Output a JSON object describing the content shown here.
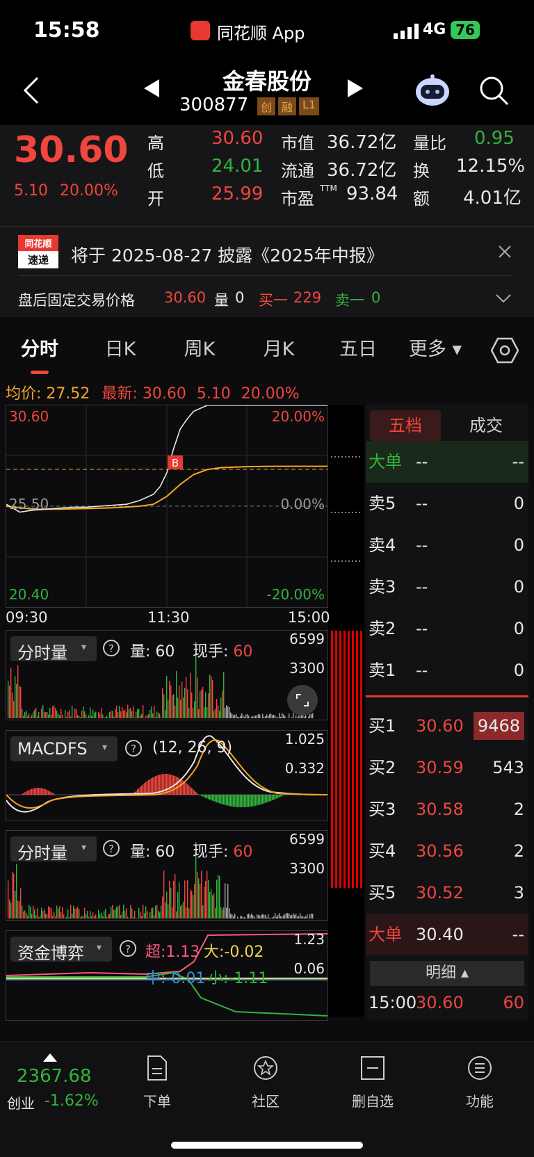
{
  "status": {
    "time": "15:58",
    "app": "同花顺 App",
    "network": "4G",
    "battery": "76"
  },
  "header": {
    "stock_name": "金春股份",
    "stock_code": "300877",
    "badges": [
      "创",
      "融",
      "L1"
    ]
  },
  "quote": {
    "price": "30.60",
    "change": "5.10",
    "change_pct": "20.00%",
    "high_label": "高",
    "high": "30.60",
    "low_label": "低",
    "low": "24.01",
    "open_label": "开",
    "open": "25.99",
    "mcap_label": "市值",
    "mcap": "36.72亿",
    "float_label": "流通",
    "float": "36.72亿",
    "pe_label": "市盈",
    "pe_sup": "TTM",
    "pe": "93.84",
    "vr_label": "量比",
    "vr": "0.95",
    "turn_label": "换",
    "turn": "12.15%",
    "amt_label": "额",
    "amt": "4.01亿"
  },
  "notice": {
    "logo_top": "同花顺",
    "logo_bottom": "速递",
    "text": "将于 2025-08-27 披露《2025年中报》",
    "after_label": "盘后固定交易价格",
    "after_price": "30.60",
    "vol_label": "量",
    "vol": "0",
    "buy1_label": "买一",
    "buy1": "229",
    "sell1_label": "卖一",
    "sell1": "0"
  },
  "tabs": [
    "分时",
    "日K",
    "周K",
    "月K",
    "五日",
    "更多"
  ],
  "chart_info": {
    "avg_label": "均价:",
    "avg": "27.52",
    "latest_label": "最新:",
    "latest": "30.60",
    "chg": "5.10",
    "chg_pct": "20.00%"
  },
  "chart_data": {
    "type": "line",
    "y_top": "30.60",
    "y_mid": "25.50",
    "y_bottom": "20.40",
    "pct_top": "20.00%",
    "pct_mid": "0.00%",
    "pct_bottom": "-20.00%",
    "times": [
      "09:30",
      "11:30",
      "15:00"
    ],
    "marker": "B",
    "ylim": [
      20.4,
      30.6
    ],
    "series": [
      {
        "x": [
          0,
          10,
          20,
          30,
          40,
          50,
          60,
          70,
          80,
          90,
          100,
          110,
          115,
          120,
          125,
          130,
          135,
          140,
          150,
          160,
          170,
          180,
          200,
          220,
          240
        ],
        "values": [
          25.6,
          25.2,
          25.3,
          25.35,
          25.4,
          25.45,
          25.45,
          25.5,
          25.55,
          25.6,
          25.8,
          26.1,
          26.5,
          27.2,
          28.4,
          29.4,
          29.9,
          30.3,
          30.6,
          30.6,
          30.6,
          30.6,
          30.6,
          30.6,
          30.6
        ]
      },
      {
        "x": [
          0,
          20,
          40,
          60,
          80,
          100,
          110,
          120,
          130,
          140,
          150,
          160,
          180,
          200,
          220,
          240
        ],
        "values": [
          25.5,
          25.35,
          25.35,
          25.38,
          25.42,
          25.5,
          25.6,
          26.0,
          26.6,
          27.1,
          27.35,
          27.45,
          27.5,
          27.52,
          27.52,
          27.52
        ]
      }
    ]
  },
  "ind1": {
    "name": "分时量",
    "vol_label": "量:",
    "vol": "60",
    "now_label": "现手:",
    "now": "60",
    "y1": "6599",
    "y2": "3300"
  },
  "ind2": {
    "name": "MACDFS",
    "params": "(12, 26, 9)",
    "y1": "1.025",
    "y2": "0.332"
  },
  "ind3": {
    "name": "分时量",
    "vol_label": "量:",
    "vol": "60",
    "now_label": "现手:",
    "now": "60",
    "y1": "6599",
    "y2": "3300"
  },
  "ind4": {
    "name": "资金博弈",
    "super_label": "超:",
    "super": "1.13",
    "big_label": "大:",
    "big": "-0.02",
    "mid_label": "中:",
    "mid": "-0.01",
    "small_label": "小:",
    "small": "-1.11",
    "y1": "1.23",
    "y2": "0.06"
  },
  "orderbook": {
    "tabs": [
      "五档",
      "成交"
    ],
    "big_label": "大单",
    "big_price": "--",
    "big_vol": "--",
    "asks": [
      {
        "label": "卖5",
        "price": "--",
        "vol": "0"
      },
      {
        "label": "卖4",
        "price": "--",
        "vol": "0"
      },
      {
        "label": "卖3",
        "price": "--",
        "vol": "0"
      },
      {
        "label": "卖2",
        "price": "--",
        "vol": "0"
      },
      {
        "label": "卖1",
        "price": "--",
        "vol": "0"
      }
    ],
    "bids": [
      {
        "label": "买1",
        "price": "30.60",
        "vol": "9468"
      },
      {
        "label": "买2",
        "price": "30.59",
        "vol": "543"
      },
      {
        "label": "买3",
        "price": "30.58",
        "vol": "2"
      },
      {
        "label": "买4",
        "price": "30.56",
        "vol": "2"
      },
      {
        "label": "买5",
        "price": "30.52",
        "vol": "3"
      }
    ],
    "big2_label": "大单",
    "big2_price": "30.40",
    "big2_vol": "--",
    "detail_label": "明细",
    "trade": {
      "time": "15:00",
      "price": "30.60",
      "vol": "60"
    }
  },
  "bottom": {
    "index_value": "2367.68",
    "index_name": "创业",
    "index_pct": "-1.62%",
    "items": [
      "下单",
      "社区",
      "删自选",
      "功能"
    ]
  },
  "colors": {
    "up": "#f0463c",
    "down": "#32b43c",
    "avg_line": "#f5a623",
    "price_line": "#e8e8e8"
  }
}
